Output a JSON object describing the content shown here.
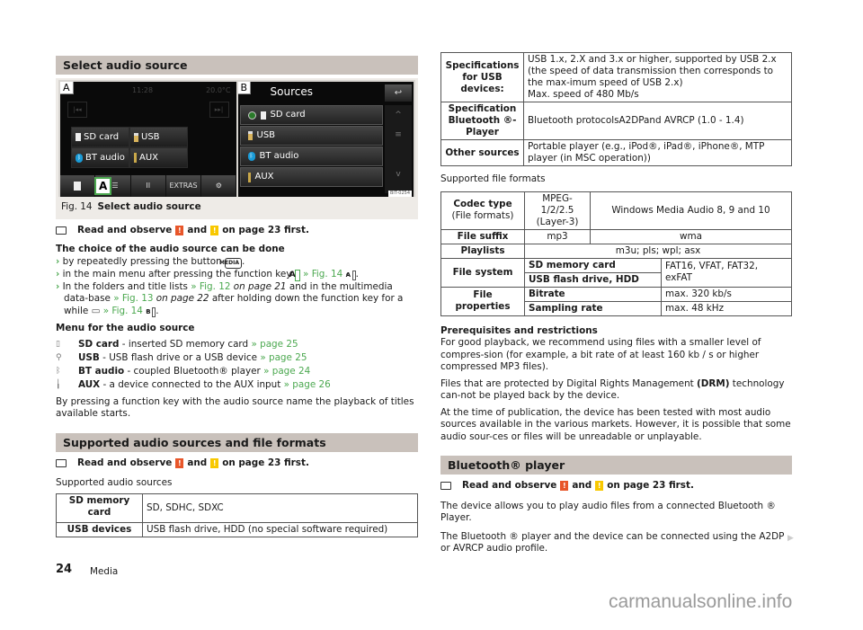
{
  "left": {
    "section1_title": "Select audio source",
    "figure": {
      "screen_a": {
        "tag": "A",
        "time": "11:28",
        "temperature": "20.0°C",
        "prev_label": "|◂◂",
        "next_label": "▸▸|",
        "sources": [
          "SD card",
          "USB",
          "BT audio",
          "AUX"
        ],
        "bottom_buttons": [
          "",
          "♪☰",
          "II",
          "EXTRAS",
          "⚙"
        ],
        "callout": "A"
      },
      "screen_b": {
        "tag": "B",
        "title": "Sources",
        "back_label": "↩",
        "items": [
          "SD card",
          "USB",
          "BT audio",
          "AUX"
        ],
        "scroll": [
          "^",
          "≡",
          "",
          "v"
        ],
        "code": "BIT-0254"
      },
      "caption_num": "Fig. 14",
      "caption_text": "Select audio source"
    },
    "observe1": {
      "pre": "Read and observe",
      "mid": "and",
      "post": "on page 23 first."
    },
    "choice_heading": "The choice of the audio source can be done",
    "bullets": [
      {
        "text": "by repeatedly pressing the button",
        "key": "MEDIA",
        "tail": "."
      },
      {
        "text": "in the main menu after pressing the function key",
        "key": "A",
        "link": "» Fig. 14",
        "dash": " - ",
        "key2": "A",
        "tail": "."
      },
      {
        "text": "In the folders and title lists",
        "link1": "» Fig. 12",
        "ital1": "on page 21",
        "mid": "and in the multimedia data-base",
        "link2": "» Fig. 13",
        "ital2": "on page 22",
        "tail": "after holding down the function key for a while",
        "link3": "» Fig. 14",
        "dash": " - ",
        "key": "B",
        "end": "."
      }
    ],
    "menu_heading": "Menu for the audio source",
    "menu_items": [
      {
        "icon": "sd-card-icon",
        "glyph": "▯",
        "name": "SD card",
        "desc": " - inserted SD memory card ",
        "link": "» page 25"
      },
      {
        "icon": "usb-icon",
        "glyph": "⚲",
        "name": "USB",
        "desc": " - USB flash drive or a USB device ",
        "link": "» page 25"
      },
      {
        "icon": "bluetooth-icon",
        "glyph": "ᛒ",
        "name": "BT audio",
        "desc": " - coupled Bluetooth® player ",
        "link": "» page 24"
      },
      {
        "icon": "aux-icon",
        "glyph": "╽",
        "name": "AUX",
        "desc": " - a device connected to the AUX input ",
        "link": "» page 26"
      }
    ],
    "press_text": "By pressing a function key with the audio source name the playback of titles available starts.",
    "section2_title": "Supported audio sources and file formats",
    "observe2": {
      "pre": "Read and observe",
      "mid": "and",
      "post": "on page 23 first."
    },
    "sources_heading": "Supported audio sources",
    "sources_table": [
      {
        "label": "SD memory card",
        "value": "SD, SDHC, SDXC"
      },
      {
        "label": "USB devices",
        "value": "USB flash drive, HDD (no special software required)"
      }
    ]
  },
  "right": {
    "spec_table": [
      {
        "label": "Specifications for USB devices:",
        "value": "USB 1.x, 2.X and 3.x or higher, supported by USB 2.x (the speed of data transmission then corresponds to the max-imum speed of USB 2.x)",
        "value2": "Max. speed of 480 Mb/s"
      },
      {
        "label": "Specification Bluetooth ®-Player",
        "value": "Bluetooth protocolsA2DPand AVRCP (1.0 - 1.4)"
      },
      {
        "label": "Other sources",
        "value": "Portable player (e.g., iPod®, iPad®, iPhone®, MTP player (in MSC operation))"
      }
    ],
    "formats_heading": "Supported file formats",
    "formats_table": {
      "codec_label": "Codec type",
      "codec_sub": "(File formats)",
      "codec_mp3": "MPEG-1/2/2.5 (Layer-3)",
      "codec_wma": "Windows Media Audio 8, 9 and 10",
      "suffix_label": "File suffix",
      "suffix_mp3": "mp3",
      "suffix_wma": "wma",
      "playlists_label": "Playlists",
      "playlists_value": "m3u; pls; wpl; asx",
      "fs_label": "File system",
      "fs_sd": "SD memory card",
      "fs_usb": "USB flash drive, HDD",
      "fs_value": "FAT16, VFAT, FAT32, exFAT",
      "props_label": "File properties",
      "bitrate_label": "Bitrate",
      "bitrate_value": "max. 320 kb/s",
      "sampling_label": "Sampling rate",
      "sampling_value": "max. 48 kHz"
    },
    "prereq_heading": "Prerequisites and restrictions",
    "prereq_text": "For good playback, we recommend using files with a smaller level of compres-sion (for example, a bit rate of at least 160 kb / s or higher compressed MP3 files).",
    "drm_pre": "Files that are protected by Digital Rights Management ",
    "drm_bold": "(DRM)",
    "drm_post": " technology can-not be played back by the device.",
    "publication_text": "At the time of publication, the device has been tested with most audio sources available in the various markets. However, it is possible that some audio sour-ces or files will be unreadable or unplayable.",
    "section3_title": "Bluetooth® player",
    "observe3": {
      "pre": "Read and observe",
      "mid": "and",
      "post": "on page 23 first."
    },
    "bt_text1": "The device allows you to play audio files from a connected Bluetooth ® Player.",
    "bt_text2": "The Bluetooth ® player and the device can be connected using the A2DP or AVRCP audio profile.",
    "continue_glyph": "▶"
  },
  "footer": {
    "page_number": "24",
    "chapter": "Media"
  },
  "watermark": "carmanualsonline.info",
  "colors": {
    "section_bg": "#c9c1bb",
    "link_green": "#4ba84f",
    "warning_red": "#e8562a",
    "warning_yellow": "#f8c800"
  }
}
